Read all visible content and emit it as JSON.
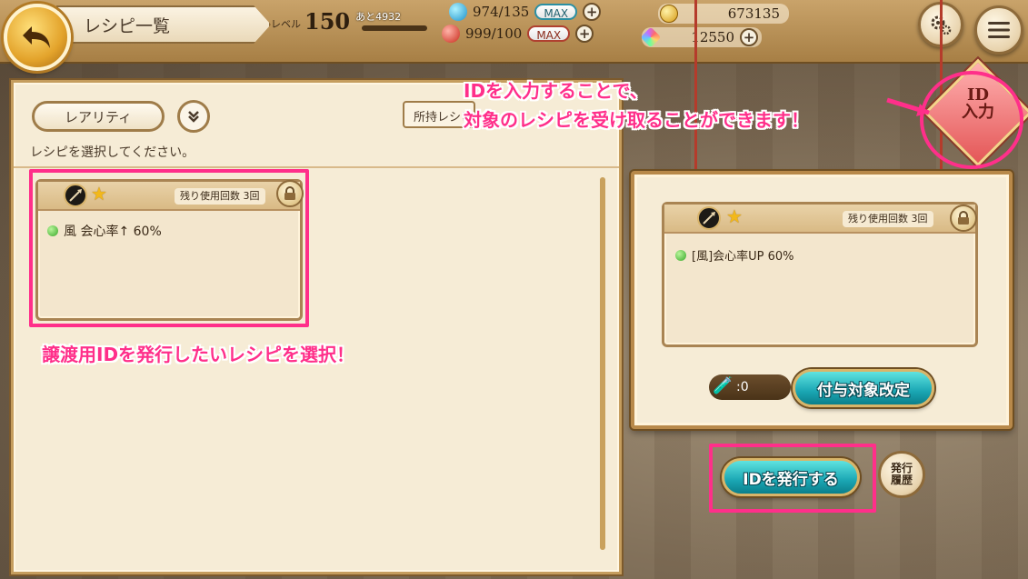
{
  "header": {
    "title": "レシピ一覧",
    "level_label": "レベル",
    "level": "150",
    "next_exp": "あと4932",
    "stamina_blue": "974/135",
    "stamina_blue_badge": "MAX",
    "stamina_red": "999/100",
    "stamina_red_badge": "MAX",
    "gold": "673135",
    "gems": "12550",
    "plus": "+"
  },
  "left_panel": {
    "rarity_button": "レアリティ",
    "owned_tab": "所持レシピ",
    "instruction": "レシピを選択してください。",
    "card": {
      "uses": "残り使用回数 3回",
      "effect": "風 会心率↑ 60%"
    }
  },
  "preview": {
    "uses": "残り使用回数 3回",
    "effect": "[風]会心率UP 60%",
    "potion_count": ":0",
    "change_target_button": "付与対象改定"
  },
  "actions": {
    "issue_id_button": "IDを発行する",
    "history_line1": "発行",
    "history_line2": "履歴",
    "id_input_line1": "ID",
    "id_input_line2": "入力"
  },
  "annotations": {
    "select_note": "譲渡用IDを発行したいレシピを選択！",
    "id_note_line1": "IDを入力することで、",
    "id_note_line2": "対象のレシピを受け取ることができます！"
  },
  "colors": {
    "annotation_pink": "#ff2f8a",
    "accent_teal": "#1aa6b3",
    "gold": "#e3a32b"
  }
}
